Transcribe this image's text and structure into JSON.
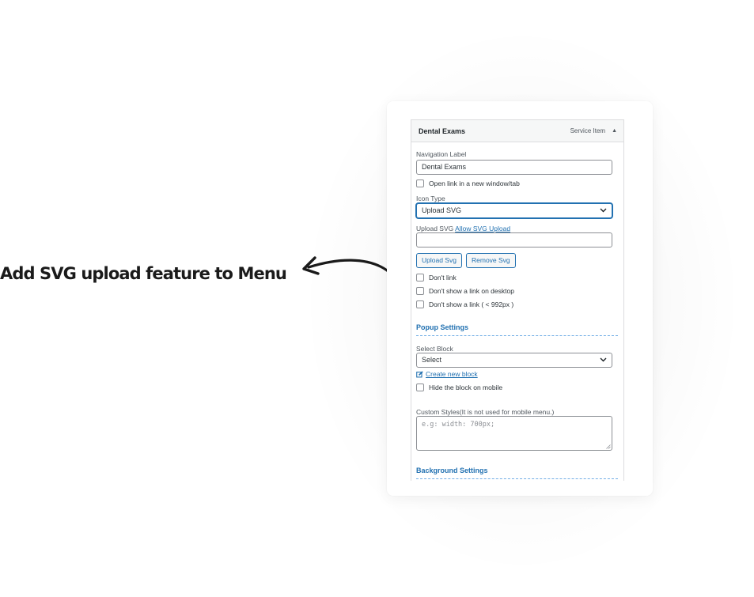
{
  "caption": "Add SVG upload feature to Menu",
  "menu_item": {
    "title": "Dental Exams",
    "type": "Service Item",
    "navigation_label": "Navigation Label",
    "navigation_value": "Dental Exams",
    "open_new_tab": "Open link in a new window/tab",
    "icon_type_label": "Icon Type",
    "icon_type_value": "Upload SVG",
    "upload_svg_label": "Upload SVG",
    "allow_svg_link": "Allow SVG Upload",
    "upload_svg_value": "",
    "upload_button": "Upload Svg",
    "remove_button": "Remove Svg",
    "dont_link": "Don't link",
    "dont_show_desktop": "Don't show a link on desktop",
    "dont_show_small": "Don't show a link ( < 992px )"
  },
  "popup_settings": {
    "heading": "Popup Settings",
    "select_block_label": "Select Block",
    "select_block_value": "Select",
    "create_block_link": "Create new block",
    "hide_mobile": "Hide the block on mobile",
    "custom_styles_label": "Custom Styles(It is not used for mobile menu.)",
    "custom_styles_placeholder": "e.g: width: 700px;"
  },
  "background_settings": {
    "heading": "Background Settings"
  },
  "colors": {
    "accent": "#2271b1",
    "border": "#8c8f94"
  }
}
